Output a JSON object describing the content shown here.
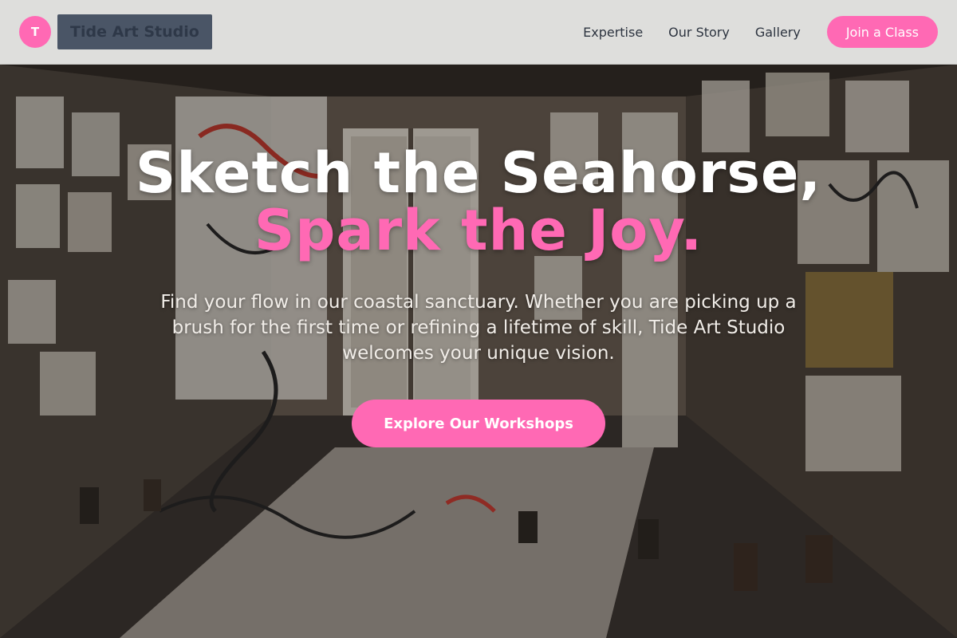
{
  "header": {
    "logo_initial": "T",
    "brand_name": "Tide Art Studio",
    "nav": [
      {
        "label": "Expertise"
      },
      {
        "label": "Our Story"
      },
      {
        "label": "Gallery"
      }
    ],
    "cta_label": "Join a Class"
  },
  "hero": {
    "headline_part1": "Sketch the Seahorse, ",
    "headline_accent": "Spark the Joy.",
    "subheading": "Find your flow in our coastal sanctuary. Whether you are picking up a brush for the first time or refining a lifetime of skill, Tide Art Studio welcomes your unique vision.",
    "cta_label": "Explore Our Workshops"
  },
  "colors": {
    "accent_pink": "#ff69b4",
    "header_bg": "#dededc",
    "brand_box": "#4a5566",
    "nav_text": "#2d3440"
  }
}
